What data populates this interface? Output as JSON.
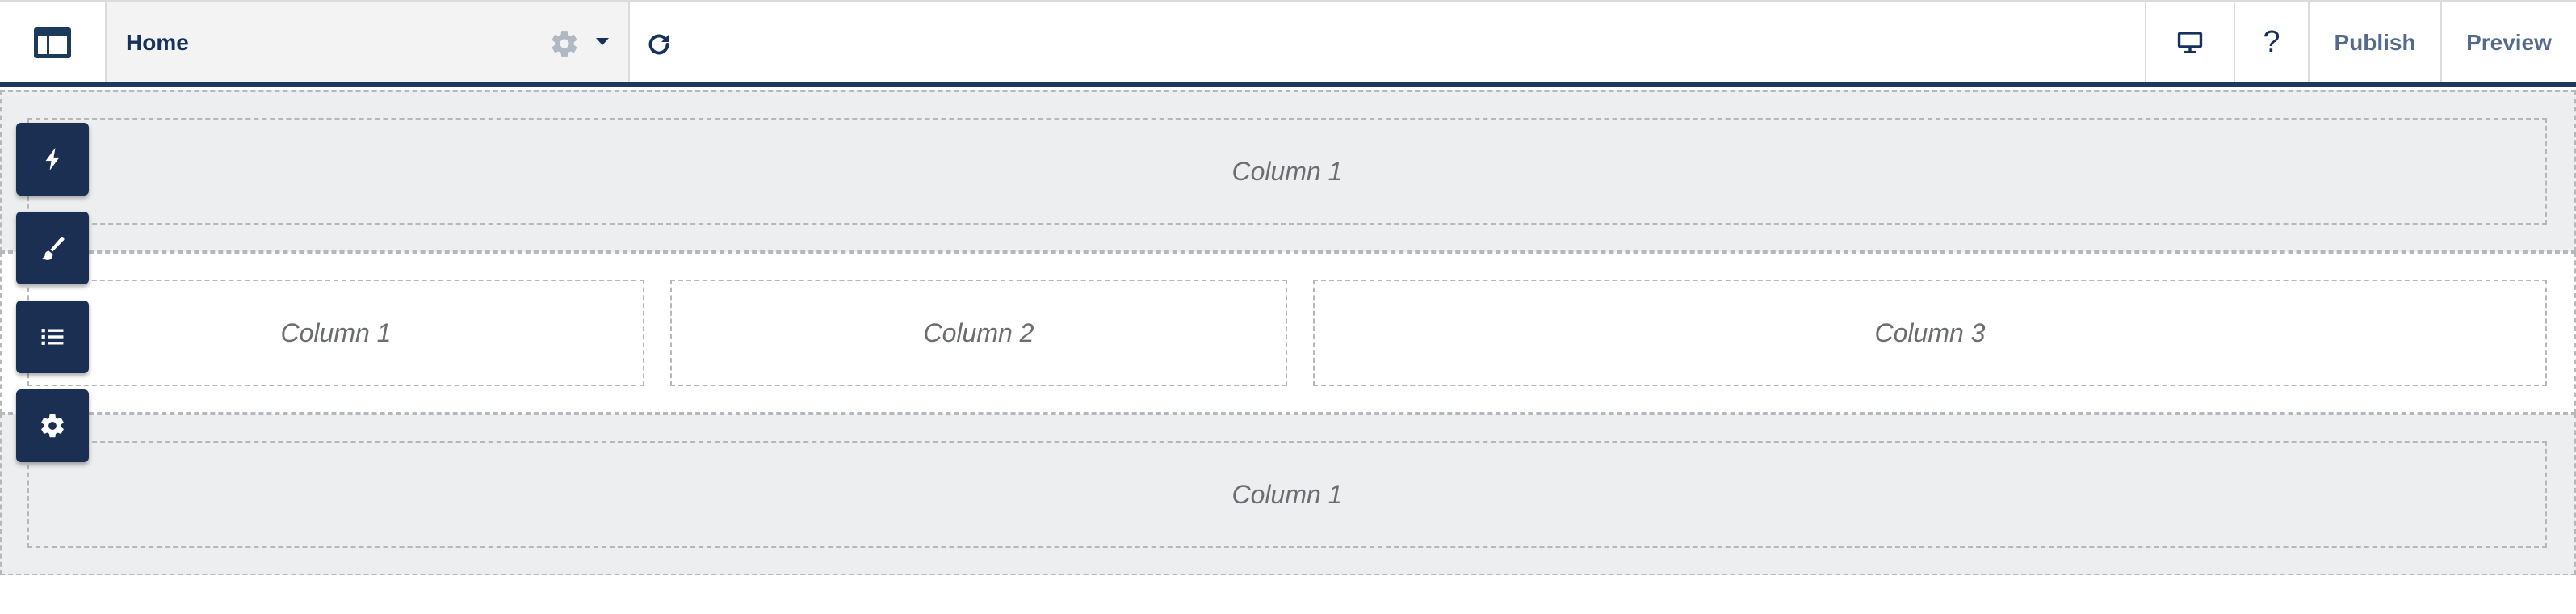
{
  "toolbar": {
    "app_icon": "layout-icon",
    "page_name": "Home",
    "page_settings_icon": "gear-icon",
    "page_menu_icon": "caret-down-icon",
    "refresh_icon": "refresh-icon",
    "device_icon": "desktop-icon",
    "help_label": "?",
    "publish_label": "Publish",
    "preview_label": "Preview"
  },
  "side_toolbar": [
    {
      "icon": "lightning-icon"
    },
    {
      "icon": "brush-icon"
    },
    {
      "icon": "list-icon"
    },
    {
      "icon": "gear-icon"
    }
  ],
  "sections": [
    {
      "columns": [
        "Column 1"
      ]
    },
    {
      "columns": [
        "Column 1",
        "Column 2",
        "Column 3"
      ]
    },
    {
      "columns": [
        "Column 1"
      ]
    }
  ],
  "colors": {
    "brand_navy": "#1b2f52",
    "toolbar_accent": "#1b3a5c",
    "section_gray": "#edeef0"
  }
}
